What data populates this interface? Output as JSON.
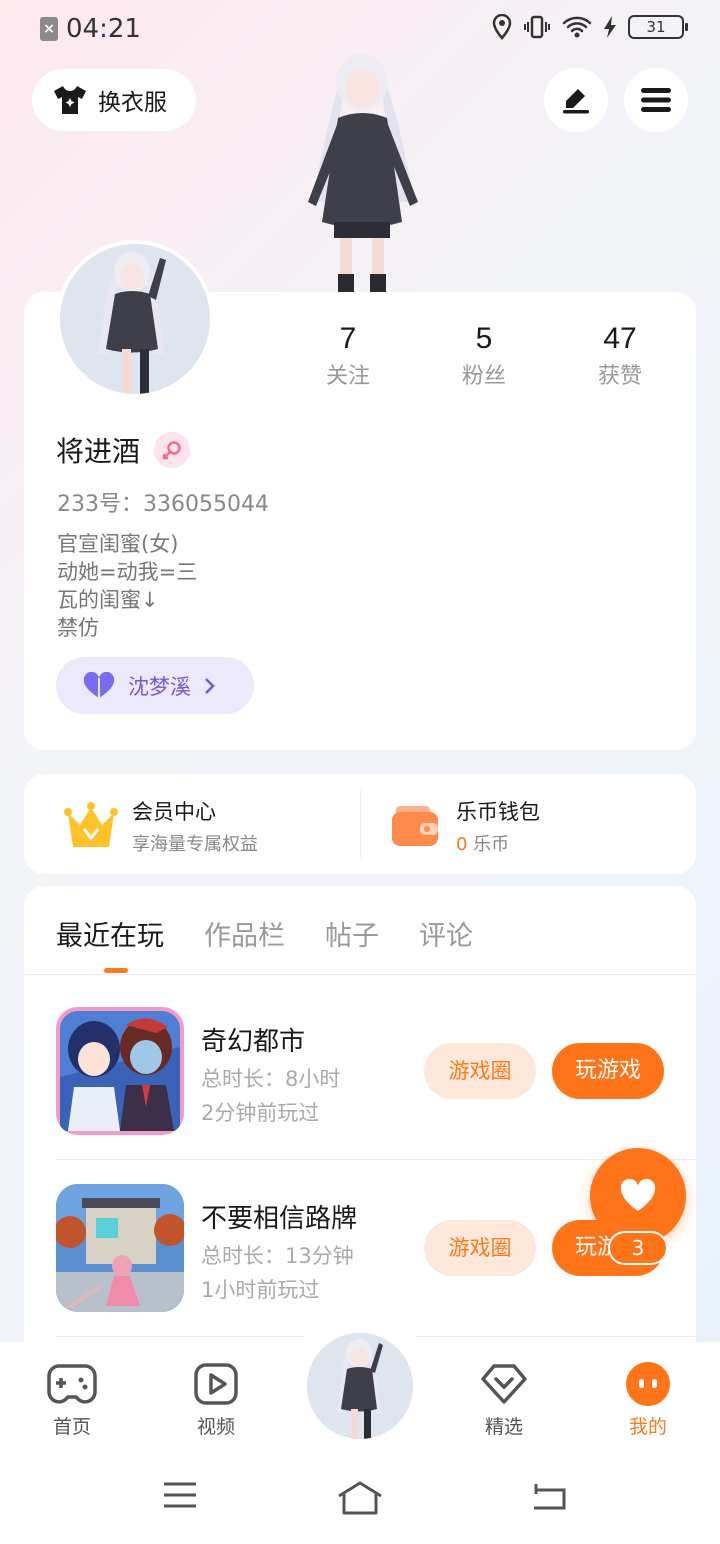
{
  "status_bar": {
    "time": "04:21",
    "battery": "31"
  },
  "header": {
    "outfit_label": "换衣服"
  },
  "profile": {
    "stats": [
      {
        "num": "7",
        "label": "关注"
      },
      {
        "num": "5",
        "label": "粉丝"
      },
      {
        "num": "47",
        "label": "获赞"
      }
    ],
    "username": "将进酒",
    "uid": "233号：336055044",
    "bio": [
      "官宣闺蜜(女)",
      "动她=动我=三",
      "瓦的闺蜜↓",
      "禁仿"
    ],
    "friend_name": "沈梦溪"
  },
  "member": {
    "title": "会员中心",
    "subtitle": "享海量专属权益"
  },
  "wallet": {
    "title": "乐币钱包",
    "coins": "0",
    "unit": " 乐币"
  },
  "tabs": [
    "最近在玩",
    "作品栏",
    "帖子",
    "评论"
  ],
  "games": [
    {
      "name": "奇幻都市",
      "duration": "总时长：8小时",
      "last": "2分钟前玩过",
      "circle_label": "游戏圈",
      "play_label": "玩游戏"
    },
    {
      "name": "不要相信路牌",
      "duration": "总时长：13分钟",
      "last": "1小时前玩过",
      "circle_label": "游戏圈",
      "play_label": "玩游戏"
    }
  ],
  "float": {
    "count": "3"
  },
  "nav": [
    {
      "label": "首页"
    },
    {
      "label": "视频"
    },
    {
      "label": "精选"
    },
    {
      "label": "我的"
    }
  ],
  "colors": {
    "accent": "#ff7419",
    "friend": "#6b5fd6"
  }
}
